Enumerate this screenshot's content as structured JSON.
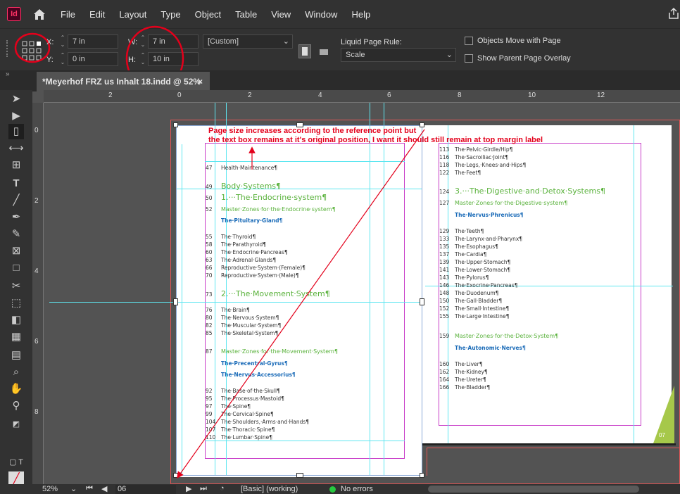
{
  "app": {
    "logo_text": "Id"
  },
  "menu": [
    "File",
    "Edit",
    "Layout",
    "Type",
    "Object",
    "Table",
    "View",
    "Window",
    "Help"
  ],
  "control": {
    "x_label": "X:",
    "x_value": "7 in",
    "y_label": "Y:",
    "y_value": "0 in",
    "w_label": "W:",
    "w_value": "7 in",
    "h_label": "H:",
    "h_value": "10 in",
    "preset": "[Custom]",
    "liquid_label": "Liquid Page Rule:",
    "liquid_value": "Scale",
    "objects_move": "Objects Move with Page",
    "show_parent": "Show Parent Page Overlay"
  },
  "tab": {
    "title": "*Meyerhof FRZ us Inhalt 18.indd @ 52%",
    "close": "×"
  },
  "ruler_h": [
    "2",
    "0",
    "2",
    "4",
    "6",
    "8",
    "10",
    "12"
  ],
  "ruler_v": [
    "0",
    "2",
    "4",
    "6",
    "8"
  ],
  "annotation": {
    "line1": "Page size increases according to the reference point but",
    "line2": "the text box remains at it's original position, I want it should still remain at top margin label"
  },
  "left_toc": [
    {
      "n": "47",
      "t": "Health·Maintenance¶",
      "c": "s"
    },
    {
      "n": "49",
      "t": "Body·Systems¶",
      "c": "g1"
    },
    {
      "n": "50",
      "t": "1.···The·Endocrine·system¶",
      "c": "g1"
    },
    {
      "n": "52",
      "t": "Master·Zones·for·the·Endocrine·system¶",
      "c": "g2"
    },
    {
      "n": "",
      "t": "The·Pituitary·Gland¶",
      "c": "b1"
    },
    {
      "n": "55",
      "t": "The·Thyroid¶",
      "c": "s"
    },
    {
      "n": "58",
      "t": "The·Parathyroid¶",
      "c": "s"
    },
    {
      "n": "60",
      "t": "The·Endocrine·Pancreas¶",
      "c": "s"
    },
    {
      "n": "63",
      "t": "The·Adrenal·Glands¶",
      "c": "s"
    },
    {
      "n": "66",
      "t": "Reproductive·System·(Female)¶",
      "c": "s"
    },
    {
      "n": "70",
      "t": "Reproductive·System·(Male)¶",
      "c": "s"
    },
    {
      "n": "73",
      "t": "2.···The·Movement·System¶",
      "c": "g1"
    },
    {
      "n": "76",
      "t": "The·Brain¶",
      "c": "s"
    },
    {
      "n": "80",
      "t": "The·Nervous·System¶",
      "c": "s"
    },
    {
      "n": "82",
      "t": "The·Muscular·System¶",
      "c": "s"
    },
    {
      "n": "85",
      "t": "The·Skeletal·System¶",
      "c": "s"
    },
    {
      "n": "87",
      "t": "Master·Zones·for·the·Movement·System¶",
      "c": "g2"
    },
    {
      "n": "",
      "t": "The·Precentral·Gyrus¶",
      "c": "b1"
    },
    {
      "n": "",
      "t": "The·Nervus·Accessorius¶",
      "c": "b1"
    },
    {
      "n": "92",
      "t": "The·Base·of·the·Skull¶",
      "c": "s"
    },
    {
      "n": "95",
      "t": "The·Processus·Mastoid¶",
      "c": "s"
    },
    {
      "n": "97",
      "t": "The·Spine¶",
      "c": "s"
    },
    {
      "n": "99",
      "t": "The·Cervical·Spine¶",
      "c": "s"
    },
    {
      "n": "104",
      "t": "The·Shoulders,·Arms·and·Hands¶",
      "c": "s"
    },
    {
      "n": "107",
      "t": "The·Thoracic·Spine¶",
      "c": "s"
    },
    {
      "n": "110",
      "t": "The·Lumbar·Spine¶",
      "c": "s"
    }
  ],
  "right_toc": [
    {
      "n": "113",
      "t": "The·Pelvic·Girdle/Hip¶",
      "c": "s"
    },
    {
      "n": "116",
      "t": "The·Sacroiliac·Joint¶",
      "c": "s"
    },
    {
      "n": "118",
      "t": "The·Legs,·Knees·and·Hips¶",
      "c": "s"
    },
    {
      "n": "122",
      "t": "The·Feet¶",
      "c": "s"
    },
    {
      "n": "124",
      "t": "3.···The·Digestive·and·Detox·Systems¶",
      "c": "g1"
    },
    {
      "n": "127",
      "t": "Master·Zones·for·the·Digestive·system¶",
      "c": "g2"
    },
    {
      "n": "",
      "t": "The·Nervus·Phrenicus¶",
      "c": "b1"
    },
    {
      "n": "129",
      "t": "The·Teeth¶",
      "c": "s"
    },
    {
      "n": "133",
      "t": "The·Larynx·and·Pharynx¶",
      "c": "s"
    },
    {
      "n": "135",
      "t": "The·Esophagus¶",
      "c": "s"
    },
    {
      "n": "137",
      "t": "The·Cardia¶",
      "c": "s"
    },
    {
      "n": "139",
      "t": "The·Upper·Stomach¶",
      "c": "s"
    },
    {
      "n": "141",
      "t": "The·Lower·Stomach¶",
      "c": "s"
    },
    {
      "n": "143",
      "t": "The·Pylorus¶",
      "c": "s"
    },
    {
      "n": "146",
      "t": "The·Exocrine·Pancreas¶",
      "c": "s"
    },
    {
      "n": "148",
      "t": "The·Duodenum¶",
      "c": "s"
    },
    {
      "n": "150",
      "t": "The·Gall·Bladder¶",
      "c": "s"
    },
    {
      "n": "152",
      "t": "The·Small·Intestine¶",
      "c": "s"
    },
    {
      "n": "155",
      "t": "The·Large·Intestine¶",
      "c": "s"
    },
    {
      "n": "159",
      "t": "Master·Zones·for·the·Detox·System¶",
      "c": "g2"
    },
    {
      "n": "",
      "t": "The·Autonomic·Nerves¶",
      "c": "b1"
    },
    {
      "n": "160",
      "t": "The·Liver¶",
      "c": "s"
    },
    {
      "n": "162",
      "t": "The·Kidney¶",
      "c": "s"
    },
    {
      "n": "164",
      "t": "The·Ureter¶",
      "c": "s"
    },
    {
      "n": "166",
      "t": "The·Bladder¶",
      "c": "s"
    }
  ],
  "page_badge": "07",
  "status": {
    "zoom": "52%",
    "page": "06",
    "style": "[Basic] (working)",
    "errors": "No errors"
  },
  "colors": {
    "annotation": "#e3001b",
    "guide": "#5ee6f0",
    "margin": "#c83cc8",
    "accent_green": "#5ab23c"
  }
}
